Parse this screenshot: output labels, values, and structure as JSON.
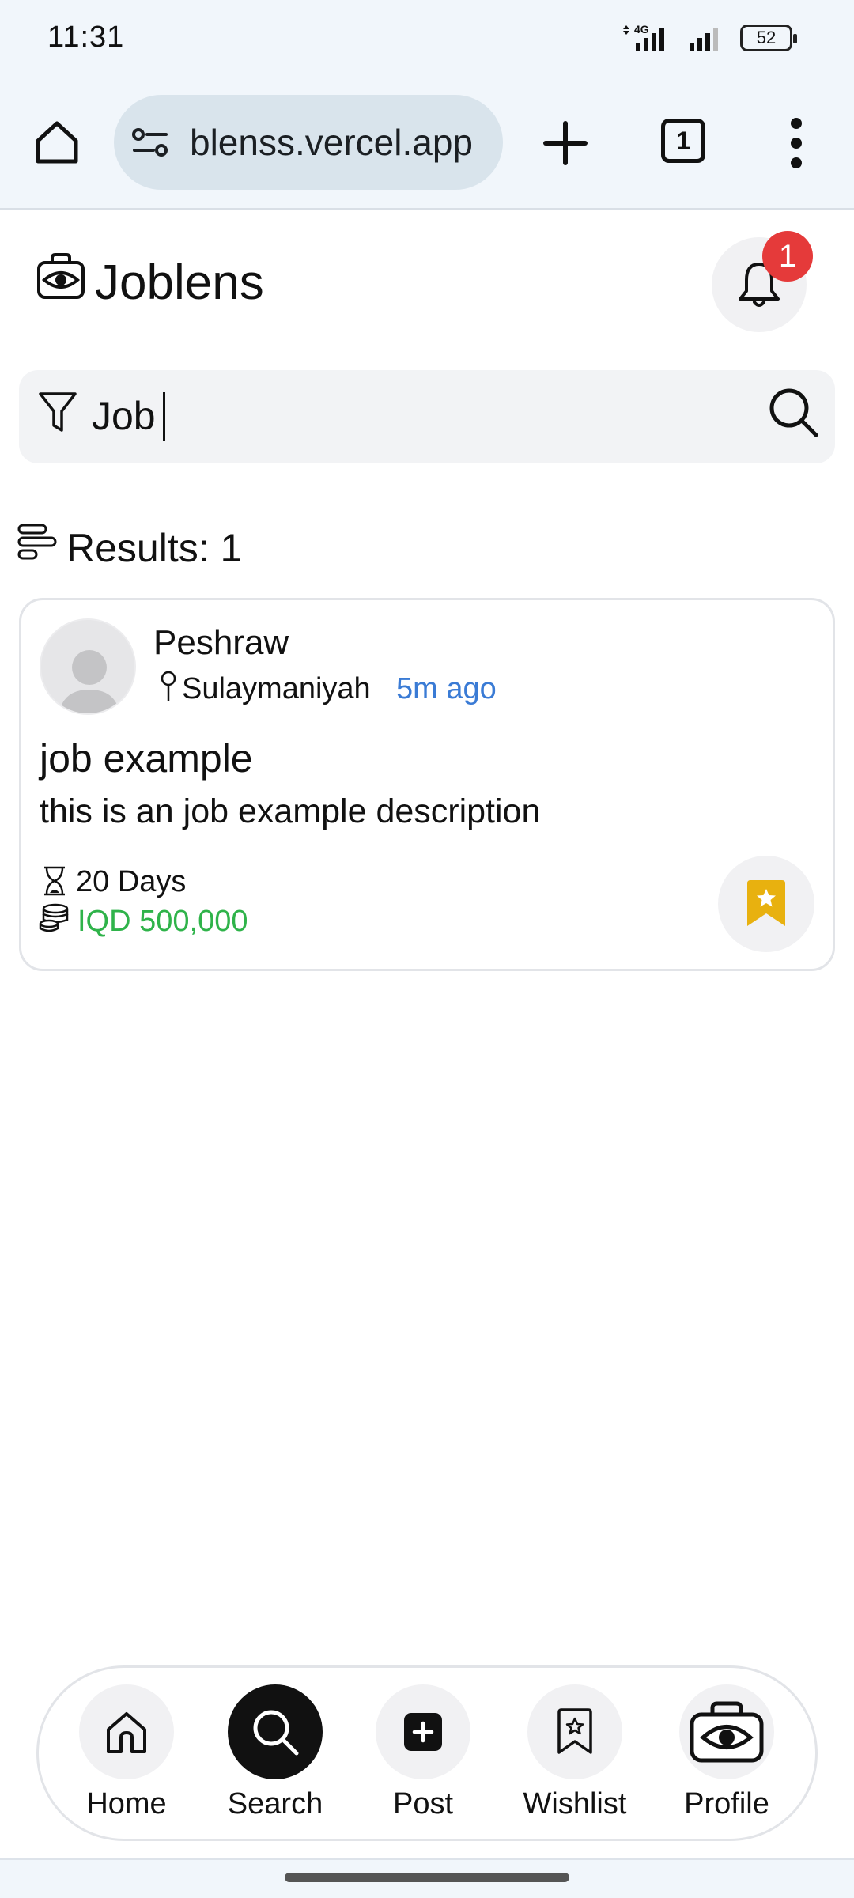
{
  "status_bar": {
    "time": "11:31",
    "network": "4G",
    "battery": "52"
  },
  "browser": {
    "url": "blenss.vercel.app",
    "tab_count": "1",
    "icons": {
      "home": "home-icon",
      "site_info": "site-settings-icon",
      "new_tab": "plus-icon",
      "menu": "more-vert-icon"
    }
  },
  "header": {
    "app_name": "Joblens",
    "notification_count": "1",
    "logo_icon": "camera-bag-eye-icon",
    "bell_icon": "bell-icon"
  },
  "search": {
    "value": "Job",
    "filter_icon": "filter-icon",
    "search_icon": "search-icon"
  },
  "results": {
    "label": "Results: 1",
    "icon": "sort-lines-icon"
  },
  "job_card": {
    "poster_name": "Peshraw",
    "location": "Sulaymaniyah",
    "posted_ago": "5m ago",
    "title": "job example",
    "description": "this is an job example description",
    "duration": "20 Days",
    "salary": "IQD 500,000",
    "bookmark_icon": "bookmark-star-icon",
    "colors": {
      "time_ago": "#3a7bd5",
      "salary": "#2fb34a",
      "bookmark": "#e8b10f"
    }
  },
  "bottom_nav": {
    "items": [
      {
        "label": "Home",
        "icon": "home-icon"
      },
      {
        "label": "Search",
        "icon": "search-icon",
        "active": true
      },
      {
        "label": "Post",
        "icon": "add-post-icon"
      },
      {
        "label": "Wishlist",
        "icon": "bookmark-star-icon"
      },
      {
        "label": "Profile",
        "icon": "camera-bag-eye-icon"
      }
    ]
  }
}
